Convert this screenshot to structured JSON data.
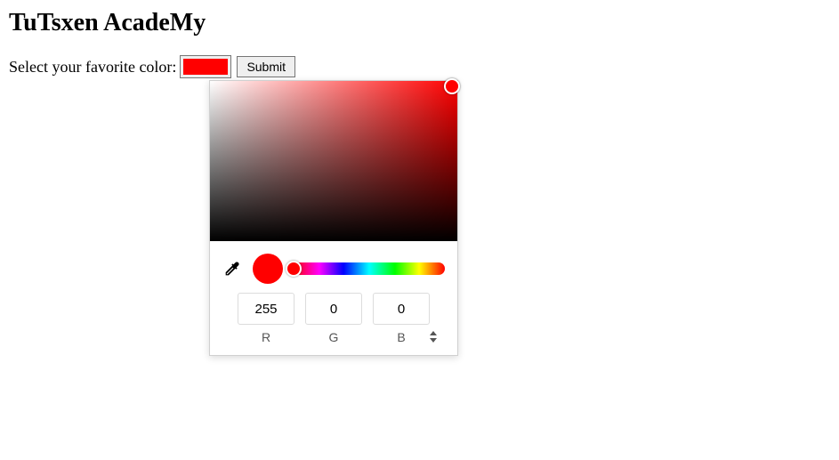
{
  "heading": "TuTsxen AcadeMy",
  "form": {
    "label": "Select your favorite color:",
    "swatch_color": "#ff0000",
    "submit_label": "Submit"
  },
  "picker": {
    "selected_hex": "#ff0000",
    "rgb": {
      "r": "255",
      "g": "0",
      "b": "0"
    },
    "labels": {
      "r": "R",
      "g": "G",
      "b": "B"
    }
  }
}
